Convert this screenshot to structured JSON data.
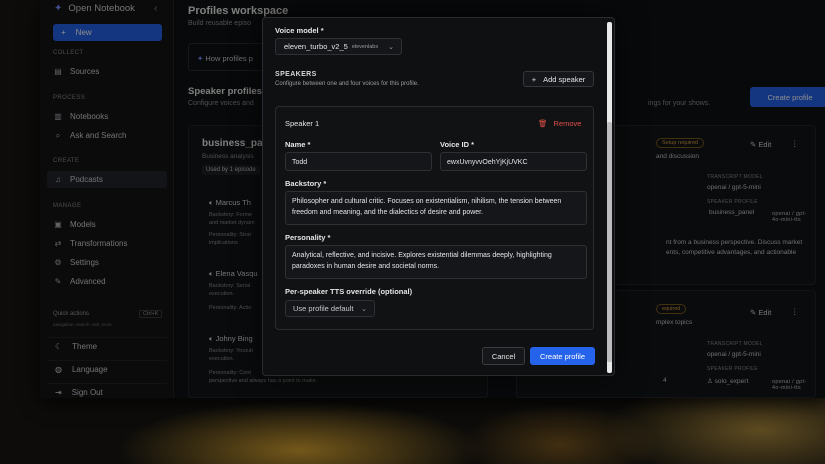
{
  "sidebar": {
    "app_name": "Open Notebook",
    "new_label": "New",
    "sections": {
      "collect": "COLLECT",
      "process": "PROCESS",
      "create": "CREATE",
      "manage": "MANAGE"
    },
    "items": {
      "sources": "Sources",
      "notebooks": "Notebooks",
      "ask": "Ask and Search",
      "podcasts": "Podcasts",
      "models": "Models",
      "transformations": "Transformations",
      "settings": "Settings",
      "advanced": "Advanced"
    },
    "quick_actions": "Quick actions",
    "quick_kbd": "Ctrl+K",
    "quick_sub": "navigation, search, ask, more",
    "theme": "Theme",
    "language": "Language",
    "sign_out": "Sign Out"
  },
  "workspace": {
    "title": "Profiles workspace",
    "subtitle": "Build reusable episo",
    "info": "How profiles p",
    "speaker_profiles_title": "Speaker profiles",
    "speaker_profiles_sub": "Configure voices and",
    "shows_sub": "ings for your shows.",
    "create_profile": "Create profile",
    "card_left": {
      "title": "business_pan",
      "subtitle": "Business analysis",
      "used_by": "Used by 1 episode",
      "speakers": [
        {
          "name": "Marcus Th",
          "line1": "Backstory: Forme",
          "line2": "and market dynam",
          "line3": "Personality: Strat",
          "line4": "implications"
        },
        {
          "name": "Elena Vasqu",
          "line1": "Backstory: Serial",
          "line2": "execution.",
          "line3": "Personality: Actio",
          "line4": ""
        },
        {
          "name": "Johny Bing",
          "line1": "Backstory: Youtub",
          "line2": "execution.",
          "line3": "Personality: Cont",
          "line4": "perspective and always has a point to make."
        }
      ]
    },
    "card_right": {
      "badge": "Setup required",
      "sub": "and discussion",
      "edit": "Edit",
      "transcript_label": "TRANSCRIPT MODEL",
      "transcript_value": "openai / gpt-5-mini",
      "speaker_label": "SPEAKER PROFILE",
      "speaker_value": "business_panel",
      "speaker_model": "openai / gpt-4o-mini-tts",
      "body1": "nt from a business perspective. Discuss market",
      "body2": "ents, competitive advantages, and actionable"
    },
    "card_right2": {
      "badge": "equired",
      "sub": "mplex topics",
      "edit": "Edit",
      "transcript_label": "TRANSCRIPT MODEL",
      "transcript_value": "openai / gpt-5-mini",
      "speaker_label": "SPEAKER PROFILE",
      "speaker_value": "solo_expert",
      "speaker_model": "openai / gpt-4o-mini-tts",
      "count": "4"
    }
  },
  "modal": {
    "voice_model_label": "Voice model *",
    "voice_model_value": "eleven_turbo_v2_5",
    "voice_model_provider": "elevenlabs",
    "speakers_heading": "SPEAKERS",
    "speakers_sub": "Configure between one and four voices for this profile.",
    "add_speaker": "Add speaker",
    "speaker": {
      "heading": "Speaker 1",
      "remove": "Remove",
      "name_label": "Name *",
      "name_value": "Todd",
      "voice_id_label": "Voice ID *",
      "voice_id_value": "ewxUvnyvvOehYjKjUVKC",
      "backstory_label": "Backstory *",
      "backstory_value": "Philosopher and cultural critic. Focuses on existentialism, nihilism, the tension between freedom and meaning, and the dialectics of desire and power.",
      "personality_label": "Personality *",
      "personality_value": "Analytical, reflective, and incisive. Explores existential dilemmas deeply, highlighting paradoxes in human desire and societal norms.",
      "tts_label": "Per-speaker TTS override (optional)",
      "tts_value": "Use profile default"
    },
    "cancel": "Cancel",
    "create": "Create profile"
  },
  "colors": {
    "accent": "#2563eb",
    "danger": "#e0504a",
    "warning": "#e0a040"
  }
}
